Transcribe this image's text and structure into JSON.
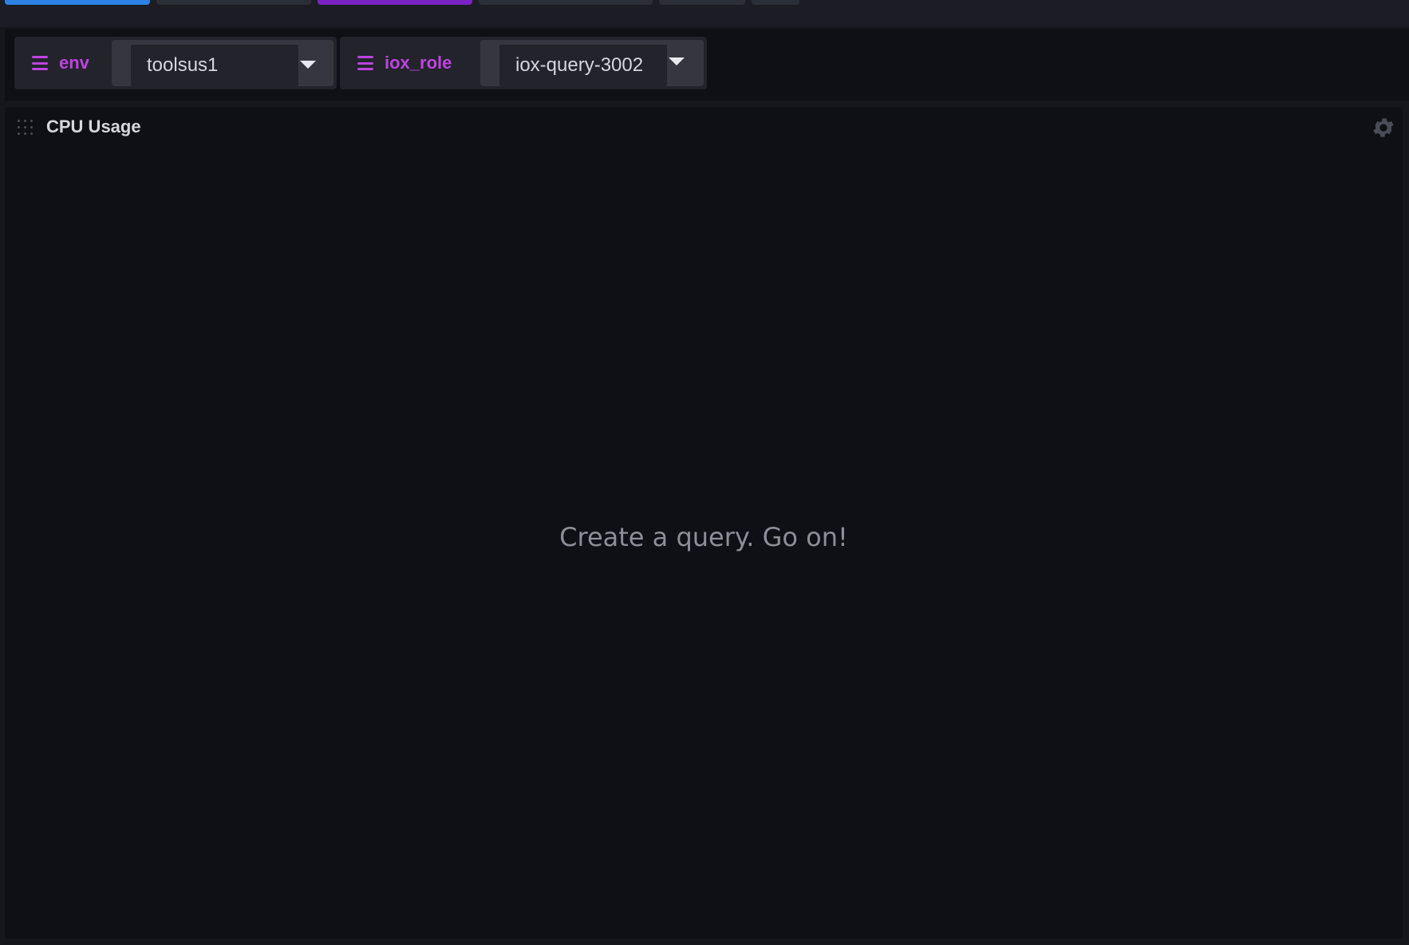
{
  "colors": {
    "accent_blue": "#2d81e3",
    "accent_purple": "#7a22c4",
    "variable_label": "#be43e1"
  },
  "variables": [
    {
      "label": "env",
      "value": "toolsus1",
      "icon": "hamburger-icon"
    },
    {
      "label": "iox_role",
      "value": "iox-query-3002",
      "icon": "hamburger-icon"
    }
  ],
  "cell": {
    "title": "CPU Usage",
    "empty_message": "Create a query. Go on!",
    "settings_icon": "gear-icon",
    "drag_icon": "drag-handle-icon"
  }
}
